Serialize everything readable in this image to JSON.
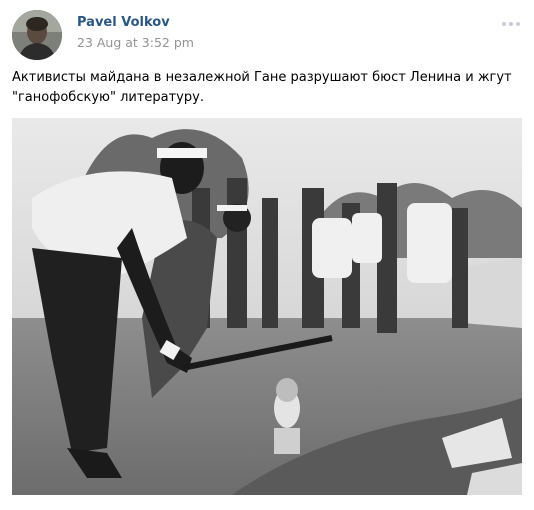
{
  "post": {
    "author": "Pavel Volkov",
    "timestamp": "23 Aug at 3:52 pm",
    "text_line1": "Активисты майдана в незалежной Гане разрушают бюст Ленина и жгут",
    "text_line2": "\"ганофобскую\" литературу.",
    "more_icon": "ellipsis-icon",
    "photo_icon": "photo-icon"
  }
}
